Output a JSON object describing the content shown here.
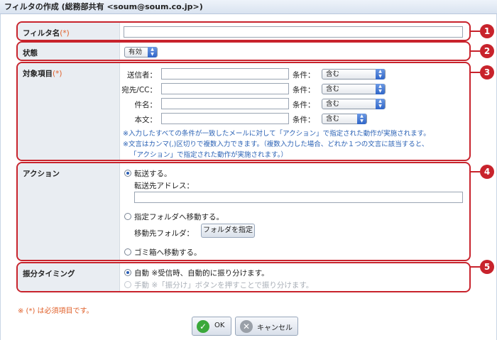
{
  "title": "フィルタの作成 (総務部共有 <soum@soum.co.jp>)",
  "sections": {
    "filter_name": {
      "label": "フィルタ名",
      "required": "(*)",
      "value": "",
      "badge": "1"
    },
    "status": {
      "label": "状態",
      "select": "有効",
      "badge": "2"
    },
    "targets": {
      "label": "対象項目",
      "required": "(*)",
      "badge": "3",
      "cond_label": "条件：",
      "rows": [
        {
          "label": "送信者：",
          "value": "",
          "cond": "含む"
        },
        {
          "label": "宛先/CC：",
          "value": "",
          "cond": "含む"
        },
        {
          "label": "件名：",
          "value": "",
          "cond": "含む"
        },
        {
          "label": "本文：",
          "value": "",
          "cond": "含む"
        }
      ],
      "notes": [
        "※入力したすべての条件が一致したメールに対して「アクション」で指定された動作が実施されます。",
        "※文言はカンマ(,)区切りで複数入力できます。（複数入力した場合、どれか１つの文言に該当すると、",
        "「アクション」で指定された動作が実施されます。）"
      ]
    },
    "action": {
      "label": "アクション",
      "badge": "4",
      "opt_forward": "転送する。",
      "forward_addr_label": "転送先アドレス：",
      "forward_addr_value": "",
      "opt_move": "指定フォルダへ移動する。",
      "move_folder_label": "移動先フォルダ：",
      "folder_button": "フォルダを指定",
      "opt_trash": "ゴミ箱へ移動する。"
    },
    "timing": {
      "label": "振分タイミング",
      "badge": "5",
      "opt_auto": "自動 ※受信時、自動的に振り分けます。",
      "opt_manual": "手動 ※「振分け」ボタンを押すことで振り分けます。"
    }
  },
  "required_note": "※ (*) は必須項目です。",
  "buttons": {
    "ok": "OK",
    "cancel": "キャンセル"
  },
  "colors": {
    "accent_red": "#c8232c",
    "note_blue": "#2b62b5",
    "required_orange": "#e0602a",
    "ok_green": "#3aa83a"
  }
}
